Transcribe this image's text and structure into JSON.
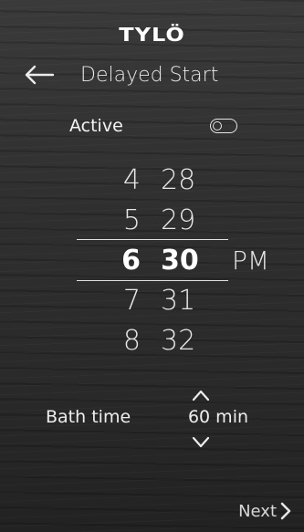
{
  "brand": {
    "logo_text": "TYLÖ"
  },
  "header": {
    "title": "Delayed Start"
  },
  "active": {
    "label": "Active",
    "state": "off"
  },
  "time_picker": {
    "rows": [
      {
        "hour": "4",
        "minute": "28"
      },
      {
        "hour": "5",
        "minute": "29"
      },
      {
        "hour": "6",
        "minute": "30"
      },
      {
        "hour": "7",
        "minute": "31"
      },
      {
        "hour": "8",
        "minute": "32"
      }
    ],
    "selected_index": 2,
    "period": "PM"
  },
  "bath_time": {
    "label": "Bath time",
    "value": "60 min"
  },
  "footer": {
    "next_label": "Next"
  },
  "colors": {
    "text": "#ececec",
    "background": "#2f2f2f",
    "line": "#e0e0e0"
  }
}
